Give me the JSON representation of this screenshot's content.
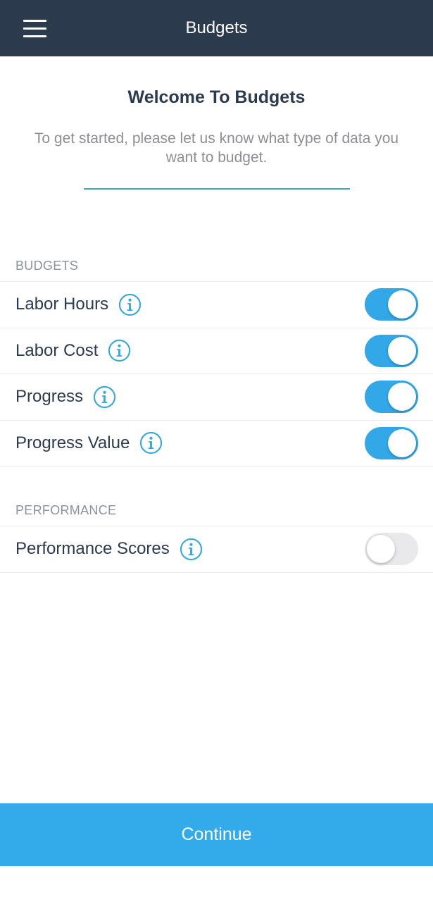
{
  "header": {
    "title": "Budgets",
    "menu_icon": "hamburger-menu-icon"
  },
  "intro": {
    "title": "Welcome To Budgets",
    "subtitle": "To get started, please let us know what type of data you want to budget."
  },
  "sections": {
    "budgets": {
      "header": "BUDGETS",
      "items": [
        {
          "label": "Labor Hours",
          "enabled": true
        },
        {
          "label": "Labor Cost",
          "enabled": true
        },
        {
          "label": "Progress",
          "enabled": true
        },
        {
          "label": "Progress Value",
          "enabled": true
        }
      ]
    },
    "performance": {
      "header": "PERFORMANCE",
      "items": [
        {
          "label": "Performance Scores",
          "enabled": false
        }
      ]
    }
  },
  "footer": {
    "continue_label": "Continue"
  },
  "colors": {
    "header_bg": "#2c3a4e",
    "accent": "#33a8e8",
    "divider_accent": "#3aa8c6",
    "toggle_off": "#e9e9eb"
  }
}
